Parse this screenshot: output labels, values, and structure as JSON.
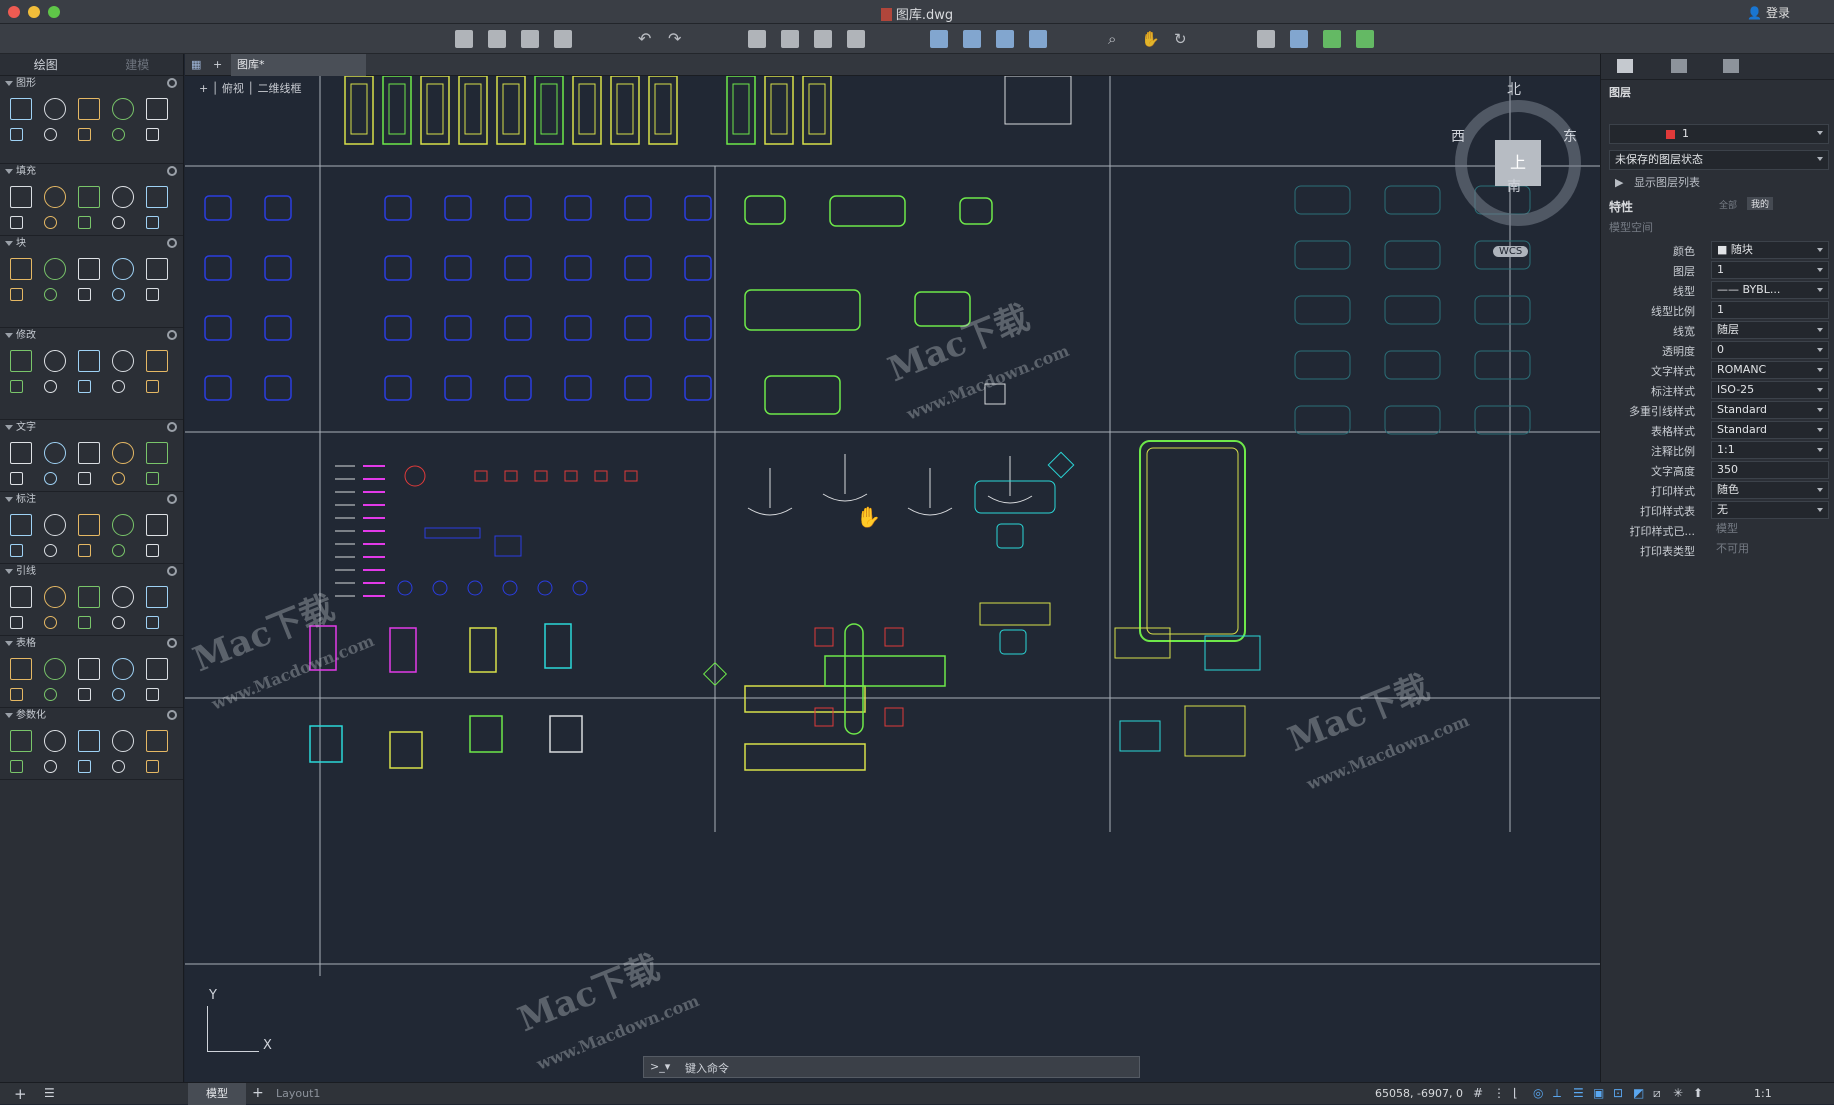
{
  "window": {
    "title": "图库.dwg",
    "login": "登录"
  },
  "left_panel": {
    "tabs": [
      "绘图",
      "建模"
    ],
    "sections": [
      "图形",
      "填充",
      "块",
      "修改",
      "文字",
      "标注",
      "引线",
      "表格",
      "参数化"
    ]
  },
  "canvas": {
    "tab_label": "图库*",
    "viewport_label_1": "俯视",
    "viewport_label_2": "二维线框",
    "viewcube": {
      "north": "北",
      "south": "南",
      "east": "东",
      "west": "西",
      "top": "上",
      "wcs": "WCS"
    },
    "ucs": {
      "y": "Y",
      "x": "X"
    }
  },
  "command_line": {
    "prompt": ">_▾",
    "placeholder": "键入命令"
  },
  "status_bar": {
    "tabs": [
      "模型",
      "Layout1"
    ],
    "coordinates": "65058, -6907, 0",
    "scale": "1:1"
  },
  "right_panel": {
    "layers_title": "图层",
    "layer_value": "1",
    "layer_state": "未保存的图层状态",
    "show_layer_list": "显示图层列表",
    "properties_title": "特性",
    "prop_tabs": [
      "全部",
      "我的"
    ],
    "model_space": "模型空间",
    "properties": [
      {
        "label": "颜色",
        "value": "■ 随块",
        "dropdown": true
      },
      {
        "label": "图层",
        "value": "1",
        "dropdown": true
      },
      {
        "label": "线型",
        "value": "—— BYBL...",
        "dropdown": true
      },
      {
        "label": "线型比例",
        "value": "1",
        "dropdown": false
      },
      {
        "label": "线宽",
        "value": "随层",
        "dropdown": true
      },
      {
        "label": "透明度",
        "value": "0",
        "dropdown": true
      },
      {
        "label": "文字样式",
        "value": "ROMANC",
        "dropdown": true
      },
      {
        "label": "标注样式",
        "value": "ISO-25",
        "dropdown": true
      },
      {
        "label": "多重引线样式",
        "value": "Standard",
        "dropdown": true
      },
      {
        "label": "表格样式",
        "value": "Standard",
        "dropdown": true
      },
      {
        "label": "注释比例",
        "value": "1:1",
        "dropdown": true
      },
      {
        "label": "文字高度",
        "value": "350",
        "dropdown": false
      },
      {
        "label": "打印样式",
        "value": "随色",
        "dropdown": true
      },
      {
        "label": "打印样式表",
        "value": "无",
        "dropdown": true
      },
      {
        "label": "打印样式已...",
        "value": "模型",
        "dropdown": false,
        "disabled": true
      },
      {
        "label": "打印表类型",
        "value": "不可用",
        "dropdown": false,
        "disabled": true
      }
    ]
  },
  "watermark": {
    "brand": "Mac下载",
    "url": "www.Macdown.com"
  },
  "colors": {
    "bg": "#212834",
    "grid": "#a9b0b8",
    "blue": "#2a3de0",
    "green": "#6ee84a",
    "yellow": "#d7e04a",
    "cyan": "#2ad8d8",
    "red": "#e03a3a",
    "magenta": "#e23ae8",
    "white": "#d8dadd"
  }
}
